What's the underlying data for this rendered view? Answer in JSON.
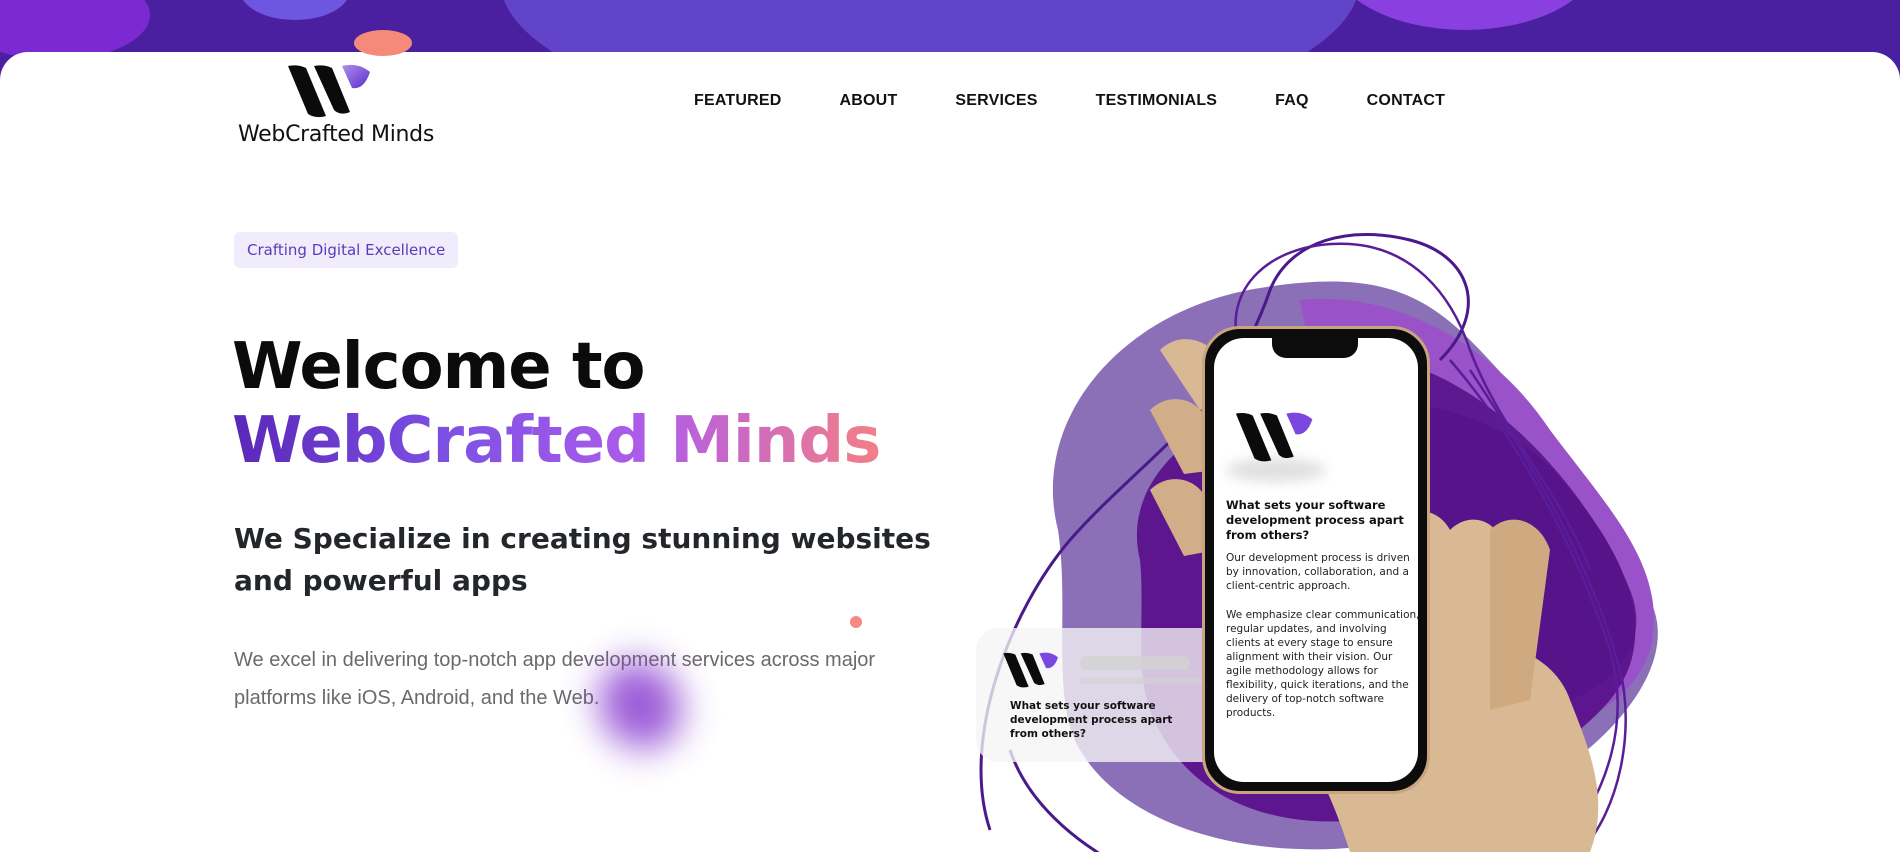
{
  "brand": {
    "name": "WebCrafted Minds",
    "accent": "#5b3bb8",
    "gradient": [
      "#5a28b8",
      "#7f52e6",
      "#b15ce8",
      "#f47f86"
    ]
  },
  "nav": {
    "items": [
      {
        "label": "FEATURED"
      },
      {
        "label": "ABOUT"
      },
      {
        "label": "SERVICES"
      },
      {
        "label": "TESTIMONIALS"
      },
      {
        "label": "FAQ"
      },
      {
        "label": "CONTACT"
      }
    ]
  },
  "hero": {
    "tagline": "Crafting Digital Excellence",
    "headline_line1": "Welcome to",
    "headline_line2": "WebCrafted Minds",
    "subheading": "We Specialize in creating stunning websites and powerful apps",
    "description": "We excel in delivering top-notch app development services across major platforms like iOS, Android, and the Web."
  },
  "phone": {
    "question": "What sets your software development process apart from others?",
    "paragraph1": "Our development process is driven by innovation, collaboration, and a client-centric approach.",
    "paragraph2": "We emphasize clear communication, regular updates, and involving clients at every stage to ensure alignment with their vision. Our agile methodology allows for flexibility, quick iterations, and the delivery of top-notch software products."
  },
  "card": {
    "question": "What sets your software development process apart from others?"
  },
  "icons": {
    "logo": "brand-logo-icon"
  }
}
